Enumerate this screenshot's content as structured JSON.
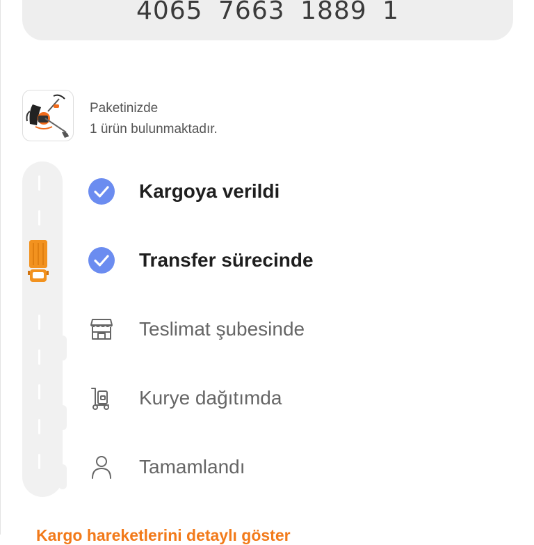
{
  "tracking": {
    "number": "4065  7663  1889  1"
  },
  "package": {
    "line1": "Paketinizde",
    "line2": "1 ürün bulunmaktadır."
  },
  "steps": [
    {
      "label": "Kargoya verildi",
      "status": "done",
      "icon": "check-circle-icon"
    },
    {
      "label": "Transfer sürecinde",
      "status": "done",
      "icon": "check-circle-icon"
    },
    {
      "label": "Teslimat şubesinde",
      "status": "pending",
      "icon": "store-icon"
    },
    {
      "label": "Kurye dağıtımda",
      "status": "pending",
      "icon": "courier-dolly-icon"
    },
    {
      "label": "Tamamlandı",
      "status": "pending",
      "icon": "person-icon"
    }
  ],
  "links": {
    "details": "Kargo hareketlerini detaylı göster"
  },
  "colors": {
    "check": "#6b8cf0",
    "truck": "#f2921f",
    "link": "#f27a1a"
  }
}
